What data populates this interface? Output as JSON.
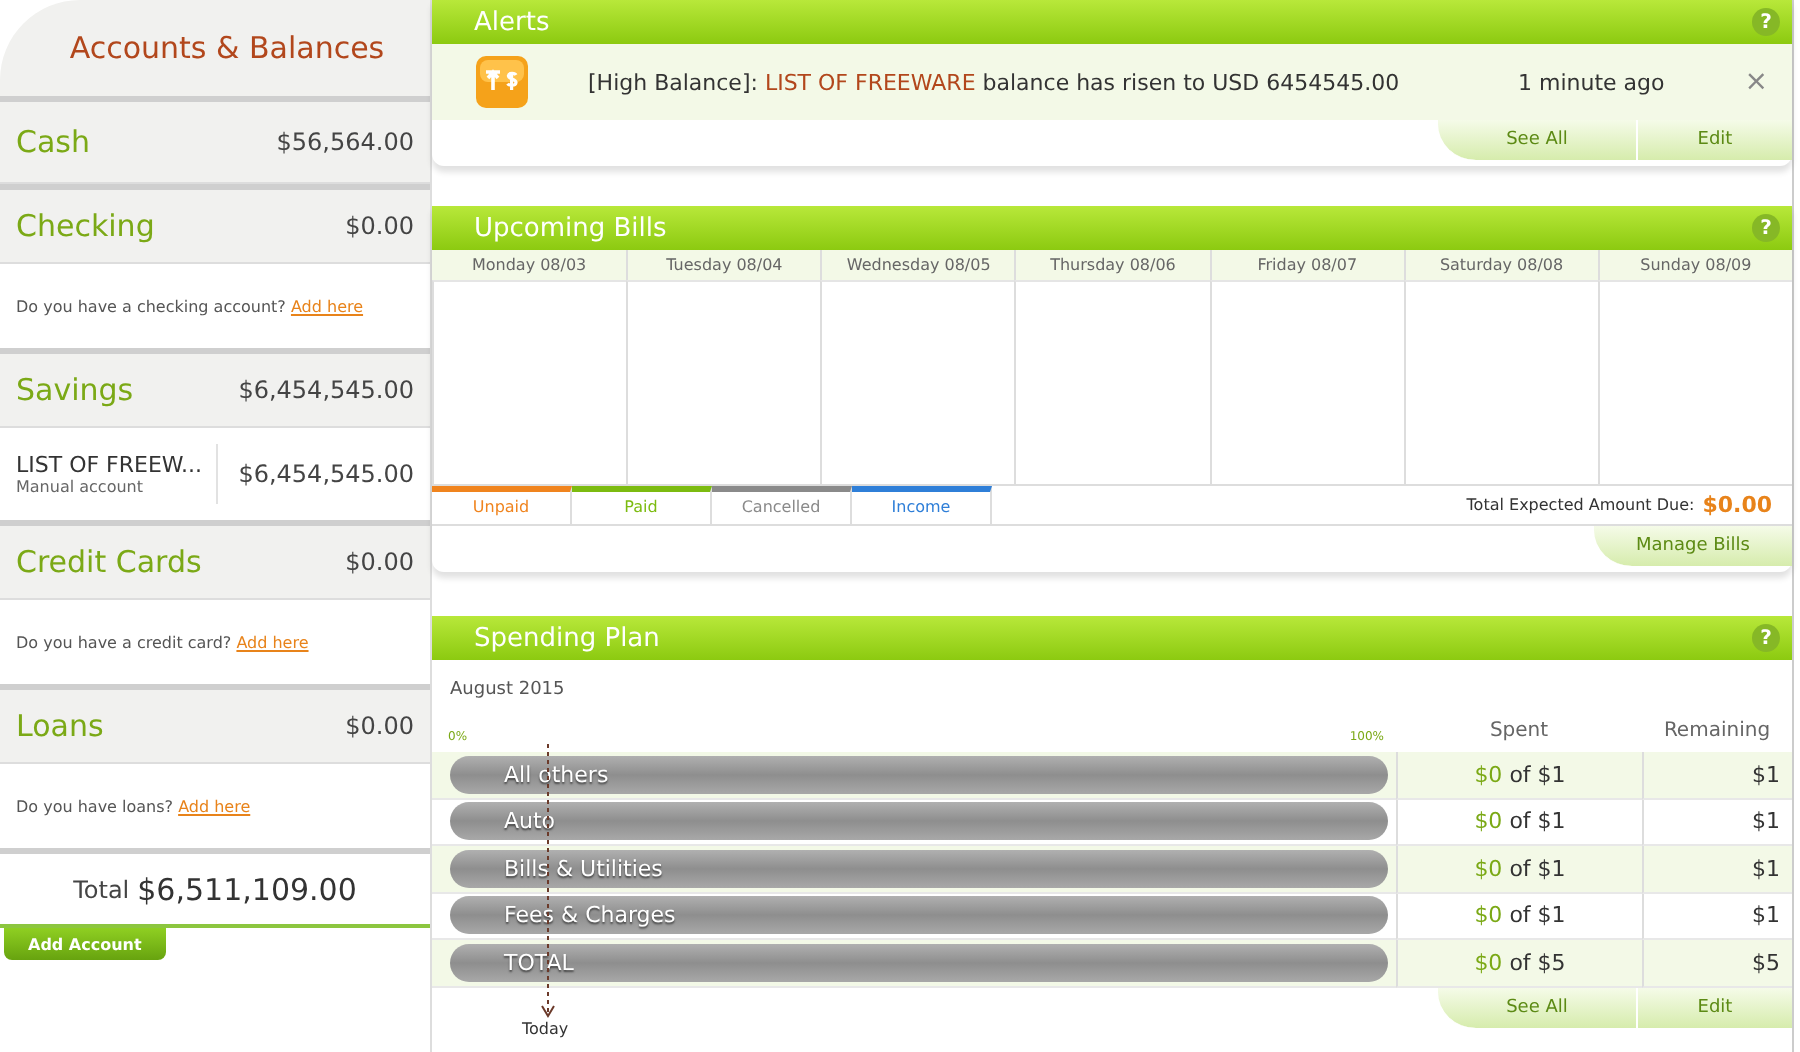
{
  "sidebar": {
    "title": "Accounts & Balances",
    "groups": [
      {
        "name": "Cash",
        "amount": "$56,564.00"
      },
      {
        "name": "Checking",
        "amount": "$0.00",
        "prompt": "Do you have a checking account?",
        "link": "Add here"
      },
      {
        "name": "Savings",
        "amount": "$6,454,545.00",
        "accounts": [
          {
            "name": "LIST OF FREEW...",
            "type": "Manual account",
            "amount": "$6,454,545.00"
          }
        ]
      },
      {
        "name": "Credit Cards",
        "amount": "$0.00",
        "prompt": "Do you have a credit card?",
        "link": "Add here"
      },
      {
        "name": "Loans",
        "amount": "$0.00",
        "prompt": "Do you have loans?",
        "link": "Add here"
      }
    ],
    "total_label": "Total",
    "total": "$6,511,109.00",
    "add_button": "Add Account"
  },
  "alerts": {
    "title": "Alerts",
    "help": "?",
    "items": [
      {
        "prefix": "[High Balance]:",
        "account": "LIST OF FREEWARE",
        "message": "balance has risen to USD 6454545.00",
        "time": "1 minute ago",
        "close": "×"
      }
    ],
    "buttons": [
      "See All",
      "Edit"
    ]
  },
  "bills": {
    "title": "Upcoming Bills",
    "help": "?",
    "days": [
      "Monday 08/03",
      "Tuesday 08/04",
      "Wednesday 08/05",
      "Thursday 08/06",
      "Friday 08/07",
      "Saturday 08/08",
      "Sunday 08/09"
    ],
    "legend": [
      {
        "label": "Unpaid",
        "color": "#f0841e"
      },
      {
        "label": "Paid",
        "color": "#7cbb10"
      },
      {
        "label": "Cancelled",
        "color": "#8a8a8a"
      },
      {
        "label": "Income",
        "color": "#2f7fd8"
      }
    ],
    "total_label": "Total Expected Amount Due:",
    "total": "$0.00",
    "buttons": [
      "Manage Bills"
    ]
  },
  "spending": {
    "title": "Spending Plan",
    "help": "?",
    "month": "August 2015",
    "scale_min": "0%",
    "scale_max": "100%",
    "columns": [
      "Spent",
      "Remaining"
    ],
    "rows": [
      {
        "name": "All others",
        "level": 0,
        "spent": "$0",
        "budget": "of $1",
        "remaining": "$1"
      },
      {
        "name": "Auto",
        "level": 0,
        "spent": "$0",
        "budget": "of $1",
        "remaining": "$1"
      },
      {
        "name": "Bills & Utilities",
        "level": 0,
        "spent": "$0",
        "budget": "of $1",
        "remaining": "$1"
      },
      {
        "name": "Fees & Charges",
        "level": 0,
        "spent": "$0",
        "budget": "of $1",
        "remaining": "$1"
      },
      {
        "name": "TOTAL",
        "level": 0,
        "spent": "$0",
        "budget": "of $5",
        "remaining": "$5"
      }
    ],
    "today": "Today",
    "buttons": [
      "See All",
      "Edit"
    ]
  }
}
